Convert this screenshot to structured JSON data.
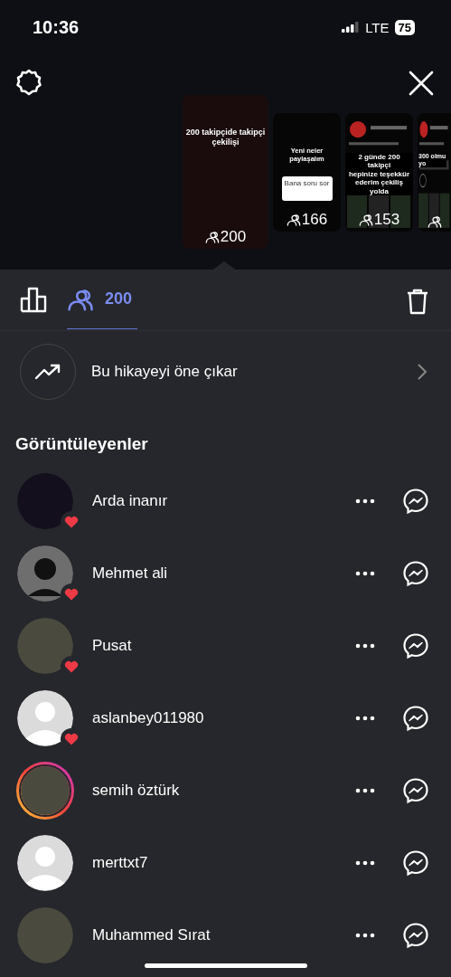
{
  "status_bar": {
    "time": "10:36",
    "network": "LTE",
    "battery": "75"
  },
  "stories": [
    {
      "kind": "text",
      "selected": true,
      "caption": "200 takipçide takipçi\nçekilişi",
      "count": "200"
    },
    {
      "kind": "question",
      "selected": false,
      "caption": "Yeni neler paylaşalım",
      "sticker": "Bana soru sor",
      "count": "166"
    },
    {
      "kind": "screenshot",
      "selected": false,
      "caption": "2 günde 200 takipçi\nhepinize teşekkür\nederim çekiliş yolda",
      "count": "153"
    },
    {
      "kind": "screenshot",
      "selected": false,
      "caption": "300 olmu\nyo"
    }
  ],
  "tabs": [
    {
      "kind": "insights",
      "selected": false
    },
    {
      "kind": "viewers",
      "selected": true,
      "label": "200"
    }
  ],
  "promote": {
    "label": "Bu hikayeyi öne çıkar"
  },
  "viewers_heading": "Görüntüleyenler",
  "viewers": [
    {
      "name": "Arda inanır",
      "kind": "dark",
      "liked": true,
      "story_ring": false
    },
    {
      "name": "Mehmet ali",
      "kind": "grey",
      "liked": true,
      "story_ring": false
    },
    {
      "name": "Pusat",
      "kind": "photo",
      "liked": true,
      "story_ring": false
    },
    {
      "name": "aslanbey011980",
      "kind": "default",
      "liked": true,
      "story_ring": false
    },
    {
      "name": "semih öztürk",
      "kind": "photo",
      "liked": false,
      "story_ring": true
    },
    {
      "name": "merttxt7",
      "kind": "default",
      "liked": false,
      "story_ring": false
    },
    {
      "name": "Muhammed Sırat",
      "kind": "photo",
      "liked": false,
      "story_ring": false
    }
  ]
}
